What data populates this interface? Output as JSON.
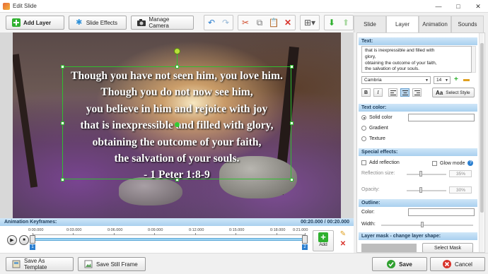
{
  "window": {
    "title": "Edit Slide",
    "minimize": "—",
    "maximize": "□",
    "close": "✕"
  },
  "toolbar": {
    "add_layer": "Add Layer",
    "slide_effects": "Slide Effects",
    "manage_camera": "Manage Camera"
  },
  "slide": {
    "verse_lines": [
      "Though you have not seen him, you love him.",
      "Though you do not now see him,",
      "you believe in him and rejoice with joy",
      "that is inexpressible and filled with glory,",
      "obtaining the outcome of your faith,",
      "the salvation of your souls.",
      "- 1 Peter 1:8-9"
    ]
  },
  "timeline": {
    "header": "Animation Keyframes:",
    "time_range": "00:20.000 / 00:20.000",
    "ruler": [
      "0:00.000",
      "0:03.000",
      "0:06.000",
      "0:09.000",
      "0:12.000",
      "0:15.000",
      "0:18.000",
      "0:21.000"
    ],
    "keyframe_labels": [
      "1",
      "2"
    ],
    "add_label": "Add"
  },
  "footer": {
    "save_template": "Save As Template",
    "save_still": "Save Still Frame",
    "save": "Save",
    "cancel": "Cancel"
  },
  "panel": {
    "tabs": [
      "Slide",
      "Layer",
      "Animation",
      "Sounds"
    ],
    "active_tab": "Layer",
    "text_section": "Text:",
    "text_value_lines": [
      "that is inexpressible and filled with",
      "glory,",
      "obtaining the outcome of your faith,",
      "the salvation of your souls."
    ],
    "font_family": "Cambria",
    "font_size": "14",
    "bold": "B",
    "italic": "I",
    "select_style": "Select Style",
    "text_color_section": "Text color:",
    "solid_color": "Solid color",
    "gradient": "Gradient",
    "texture": "Texture",
    "special_effects_section": "Special effects:",
    "add_reflection": "Add reflection",
    "glow_mode": "Glow mode",
    "reflection_size": "Reflection size:",
    "reflection_size_value": "35%",
    "opacity": "Opacity:",
    "opacity_value": "30%",
    "outline_section": "Outline:",
    "outline_color": "Color:",
    "outline_width": "Width:",
    "layer_mask_section": "Layer mask - change layer shape:",
    "select_mask": "Select Mask"
  },
  "colors": {
    "accent_blue": "#2b7fd0",
    "selection_green": "#2fbf2f",
    "section_header": "#a9d0ef"
  }
}
